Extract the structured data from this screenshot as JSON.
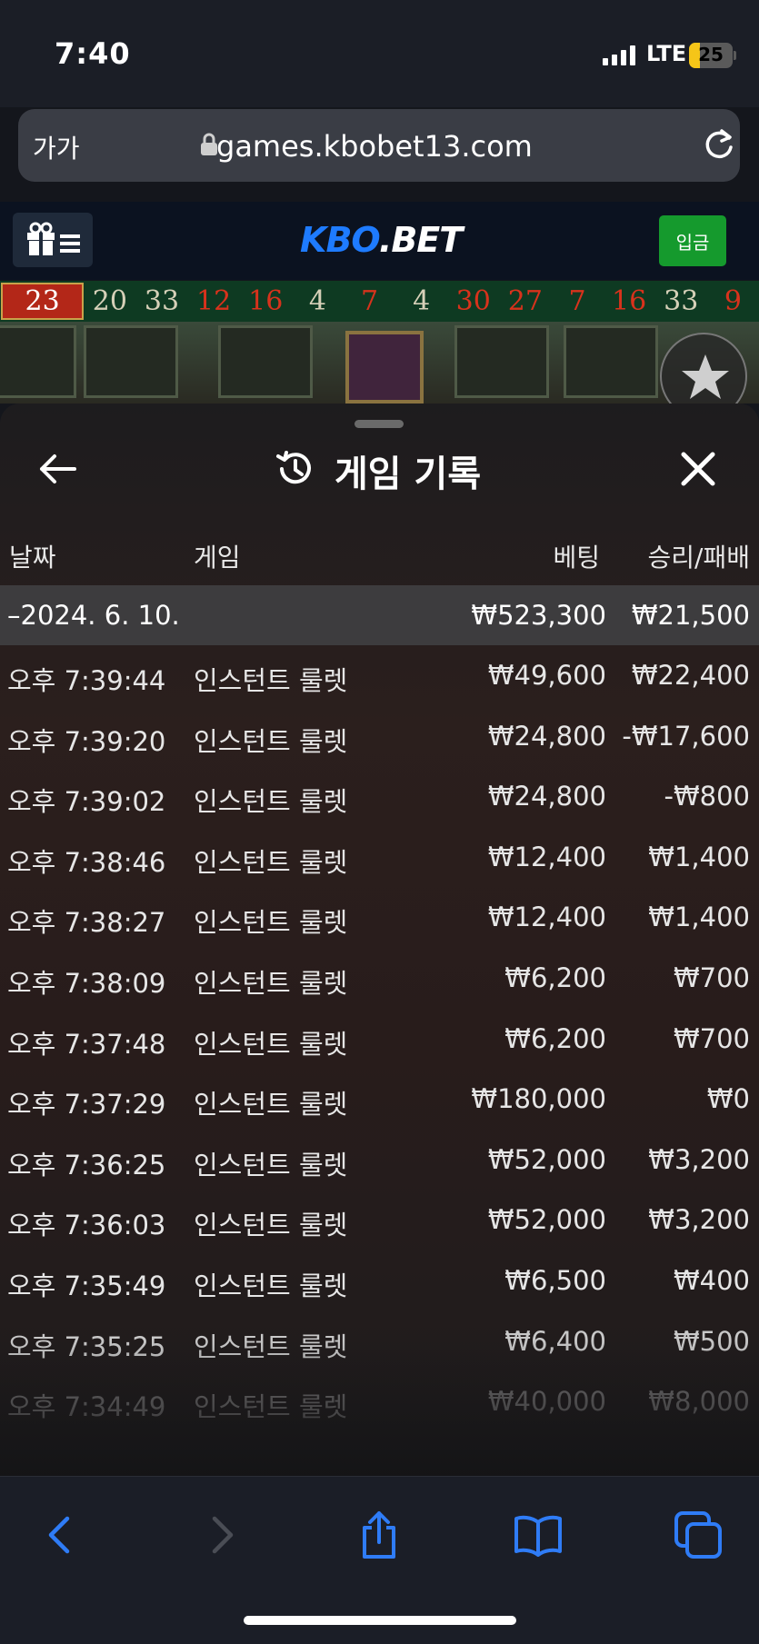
{
  "status_bar": {
    "time": "7:40",
    "network": "LTE",
    "battery": "25"
  },
  "address_bar": {
    "text_size_label": "가가",
    "url": "games.kbobet13.com"
  },
  "site_header": {
    "logo_kbo": "KBO",
    "logo_bet": ".BET",
    "deposit_label": "입금"
  },
  "results_strip": [
    {
      "n": "23",
      "c": "red"
    },
    {
      "n": "20",
      "c": "black"
    },
    {
      "n": "33",
      "c": "black"
    },
    {
      "n": "12",
      "c": "red"
    },
    {
      "n": "16",
      "c": "red"
    },
    {
      "n": "4",
      "c": "black"
    },
    {
      "n": "7",
      "c": "red"
    },
    {
      "n": "4",
      "c": "black"
    },
    {
      "n": "30",
      "c": "red"
    },
    {
      "n": "27",
      "c": "red"
    },
    {
      "n": "7",
      "c": "red"
    },
    {
      "n": "16",
      "c": "red"
    },
    {
      "n": "33",
      "c": "black"
    },
    {
      "n": "9",
      "c": "red"
    }
  ],
  "sheet": {
    "title": "게임 기록",
    "columns": {
      "date": "날짜",
      "game": "게임",
      "bet": "베팅",
      "win_loss": "승리/패배"
    },
    "date_group": {
      "date": "–2024. 6. 10.",
      "bet_total": "₩523,300",
      "win_total": "₩21,500"
    },
    "rows": [
      {
        "time": "오후 7:39:44",
        "game": "인스턴트 룰렛",
        "bet": "₩49,600",
        "result": "₩22,400"
      },
      {
        "time": "오후 7:39:20",
        "game": "인스턴트 룰렛",
        "bet": "₩24,800",
        "result": "-₩17,600"
      },
      {
        "time": "오후 7:39:02",
        "game": "인스턴트 룰렛",
        "bet": "₩24,800",
        "result": "-₩800"
      },
      {
        "time": "오후 7:38:46",
        "game": "인스턴트 룰렛",
        "bet": "₩12,400",
        "result": "₩1,400"
      },
      {
        "time": "오후 7:38:27",
        "game": "인스턴트 룰렛",
        "bet": "₩12,400",
        "result": "₩1,400"
      },
      {
        "time": "오후 7:38:09",
        "game": "인스턴트 룰렛",
        "bet": "₩6,200",
        "result": "₩700"
      },
      {
        "time": "오후 7:37:48",
        "game": "인스턴트 룰렛",
        "bet": "₩6,200",
        "result": "₩700"
      },
      {
        "time": "오후 7:37:29",
        "game": "인스턴트 룰렛",
        "bet": "₩180,000",
        "result": "₩0"
      },
      {
        "time": "오후 7:36:25",
        "game": "인스턴트 룰렛",
        "bet": "₩52,000",
        "result": "₩3,200"
      },
      {
        "time": "오후 7:36:03",
        "game": "인스턴트 룰렛",
        "bet": "₩52,000",
        "result": "₩3,200"
      },
      {
        "time": "오후 7:35:49",
        "game": "인스턴트 룰렛",
        "bet": "₩6,500",
        "result": "₩400"
      },
      {
        "time": "오후 7:35:25",
        "game": "인스턴트 룰렛",
        "bet": "₩6,400",
        "result": "₩500"
      },
      {
        "time": "오후 7:34:49",
        "game": "인스턴트 룰렛",
        "bet": "₩40,000",
        "result": "₩8,000"
      }
    ]
  },
  "icons": {
    "lock": "lock-icon",
    "reload": "reload-icon",
    "gift_menu": "gift-menu-icon",
    "star": "star-icon",
    "back": "back-arrow-icon",
    "history": "history-icon",
    "close": "close-icon",
    "safari_back": "chevron-left-icon",
    "safari_forward": "chevron-right-icon",
    "share": "share-icon",
    "bookmarks": "book-icon",
    "tabs": "tabs-icon"
  },
  "colors": {
    "accent_blue": "#1e7bff",
    "deposit_green": "#159a2d",
    "result_red": "#d8321c",
    "safari_blue": "#2f7cf6"
  }
}
